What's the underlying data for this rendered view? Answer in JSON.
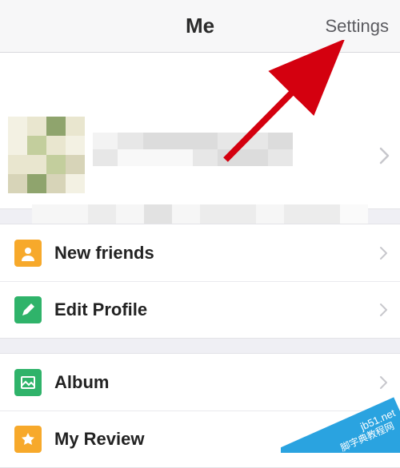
{
  "header": {
    "title": "Me",
    "settings_label": "Settings"
  },
  "menu": {
    "new_friends": "New friends",
    "edit_profile": "Edit Profile",
    "album": "Album",
    "my_review": "My Review"
  },
  "watermark": {
    "line1": "jb51.net",
    "line2": "脚字典教程网"
  },
  "annotation": {
    "note": "red arrow pointing to Settings"
  },
  "colors": {
    "accent_orange": "#f7a92b",
    "accent_green": "#2fb36a",
    "arrow_red": "#d4000f",
    "ribbon_blue": "#2aa3e0"
  }
}
